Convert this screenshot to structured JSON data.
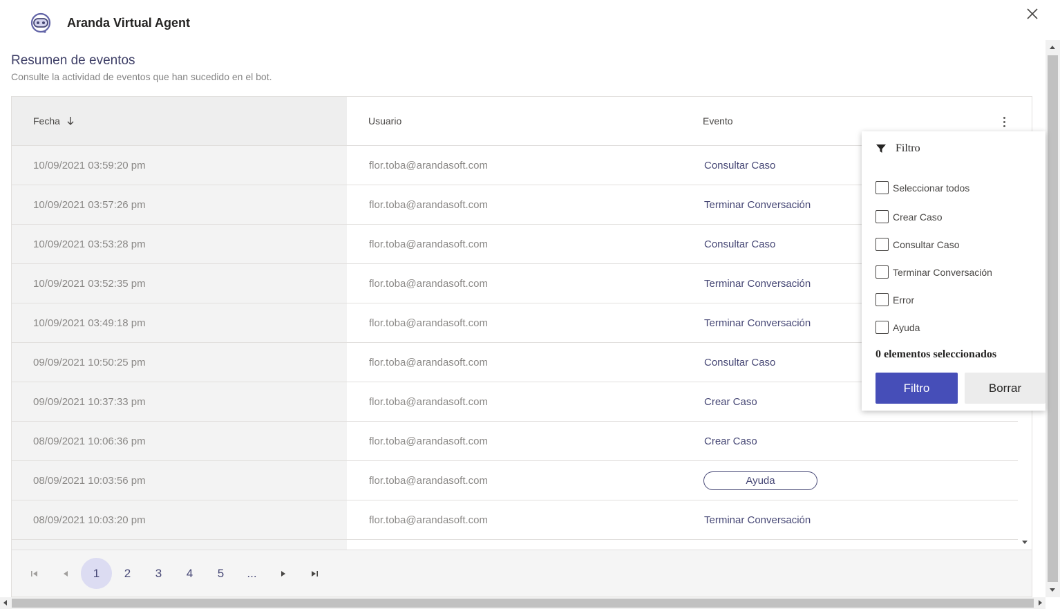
{
  "app": {
    "title": "Aranda Virtual Agent",
    "logo_icon": "bot-headset-icon",
    "accent": "#464eb8"
  },
  "page": {
    "title": "Resumen de eventos",
    "subtitle": "Consulte la actividad de eventos que han sucedido en el bot."
  },
  "table": {
    "columns": {
      "fecha": "Fecha",
      "usuario": "Usuario",
      "evento": "Evento"
    },
    "sort_column": "fecha",
    "sort_direction": "descending",
    "rows": [
      {
        "fecha": "10/09/2021 03:59:20 pm",
        "usuario": "flor.toba@arandasoft.com",
        "evento": "Consultar Caso"
      },
      {
        "fecha": "10/09/2021 03:57:26 pm",
        "usuario": "flor.toba@arandasoft.com",
        "evento": "Terminar Conversación"
      },
      {
        "fecha": "10/09/2021 03:53:28 pm",
        "usuario": "flor.toba@arandasoft.com",
        "evento": "Consultar Caso"
      },
      {
        "fecha": "10/09/2021 03:52:35 pm",
        "usuario": "flor.toba@arandasoft.com",
        "evento": "Terminar Conversación"
      },
      {
        "fecha": "10/09/2021 03:49:18 pm",
        "usuario": "flor.toba@arandasoft.com",
        "evento": "Terminar Conversación"
      },
      {
        "fecha": "09/09/2021 10:50:25 pm",
        "usuario": "flor.toba@arandasoft.com",
        "evento": "Consultar Caso"
      },
      {
        "fecha": "09/09/2021 10:37:33 pm",
        "usuario": "flor.toba@arandasoft.com",
        "evento": "Crear Caso"
      },
      {
        "fecha": "08/09/2021 10:06:36 pm",
        "usuario": "flor.toba@arandasoft.com",
        "evento": "Crear Caso"
      },
      {
        "fecha": "08/09/2021 10:03:56 pm",
        "usuario": "flor.toba@arandasoft.com",
        "evento": "Ayuda"
      },
      {
        "fecha": "08/09/2021 10:03:20 pm",
        "usuario": "flor.toba@arandasoft.com",
        "evento": "Terminar Conversación"
      }
    ]
  },
  "pagination": {
    "pages": [
      "1",
      "2",
      "3",
      "4",
      "5",
      "..."
    ],
    "current": "1"
  },
  "filter": {
    "title": "Filtro",
    "options": [
      "Seleccionar todos",
      "Crear Caso",
      "Consultar Caso",
      "Terminar Conversación",
      "Error",
      "Ayuda"
    ],
    "selected_count_text": "0 elementos seleccionados",
    "apply_label": "Filtro",
    "clear_label": "Borrar"
  }
}
